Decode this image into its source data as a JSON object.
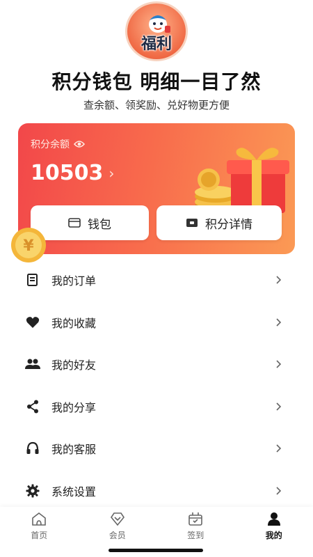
{
  "header": {
    "badge_text": "福利",
    "headline": "积分钱包 明细一目了然",
    "subheadline": "查余额、领奖励、兑好物更方便"
  },
  "points_card": {
    "label": "积分余额",
    "label_icon": "eye-icon",
    "balance": "10503",
    "arrow": "›",
    "wallet_button": "钱包",
    "points_detail_button": "积分详情",
    "gradient_start": "#f2474a",
    "gradient_end": "#fb9a55"
  },
  "menu": {
    "items": [
      {
        "label": "我的订单",
        "icon": "order-icon"
      },
      {
        "label": "我的收藏",
        "icon": "heart-icon"
      },
      {
        "label": "我的好友",
        "icon": "friends-icon"
      },
      {
        "label": "我的分享",
        "icon": "share-icon"
      },
      {
        "label": "我的客服",
        "icon": "headset-icon"
      },
      {
        "label": "系统设置",
        "icon": "gear-icon"
      }
    ]
  },
  "tabbar": {
    "tabs": [
      {
        "label": "首页",
        "icon": "home-icon",
        "active": false
      },
      {
        "label": "会员",
        "icon": "member-icon",
        "active": false
      },
      {
        "label": "签到",
        "icon": "checkin-icon",
        "active": false
      },
      {
        "label": "我的",
        "icon": "profile-icon",
        "active": true
      }
    ]
  }
}
